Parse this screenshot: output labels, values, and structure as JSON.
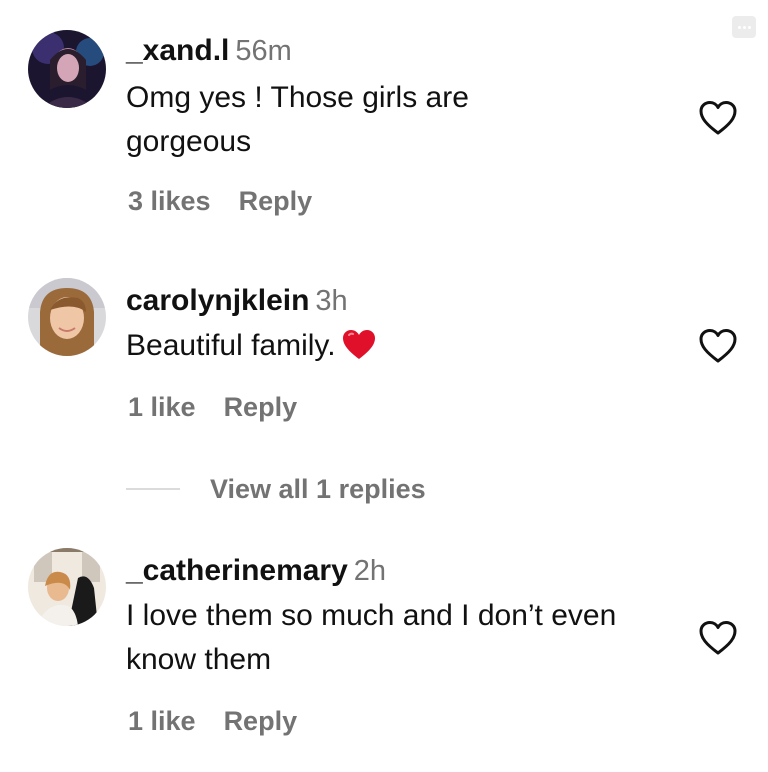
{
  "toolbar": {
    "more_icon": "more-horizontal-icon"
  },
  "comments": [
    {
      "username": "_xand.l",
      "time": "56m",
      "text": "Omg yes ! Those girls are gorgeous",
      "likes": "3 likes",
      "reply": "Reply",
      "like_icon": "heart-outline-icon"
    },
    {
      "username": "carolynjklein",
      "time": "3h",
      "text": "Beautiful family.",
      "emoji": "red-heart-emoji",
      "likes": "1 like",
      "reply": "Reply",
      "like_icon": "heart-outline-icon"
    },
    {
      "username": "_catherinemary",
      "time": "2h",
      "text": "I love them so much and I don’t even know them",
      "likes": "1 like",
      "reply": "Reply",
      "like_icon": "heart-outline-icon"
    }
  ],
  "view_replies": "View all 1 replies",
  "colors": {
    "primary_text": "#111111",
    "secondary_text": "#737373",
    "emoji_red": "#e0102a"
  }
}
